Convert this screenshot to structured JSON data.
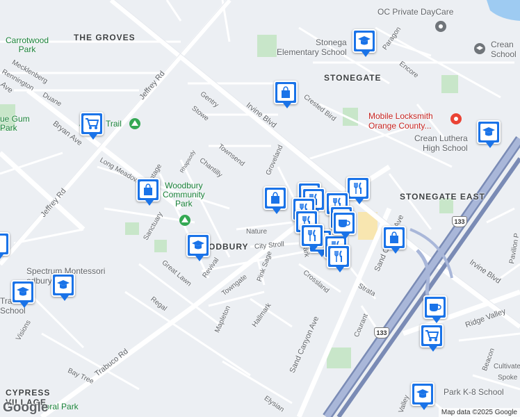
{
  "areas": [
    {
      "name": "the-groves",
      "text": "THE GROVES"
    },
    {
      "name": "stonegate",
      "text": "STONEGATE"
    },
    {
      "name": "stonegate-east",
      "text": "STONEGATE EAST"
    },
    {
      "name": "woodbury",
      "text": "ODBURY"
    },
    {
      "name": "cypress-village",
      "text": "CYPRESS\nVILLAGE"
    }
  ],
  "pois": {
    "carrotwood": "Carrotwood\nPark",
    "blue_gum": "ue Gum\nPark",
    "jeffrey_trail": "J",
    "jeffrey_trail2": "Trail",
    "woodbury_park": "Woodbury\nCommunity\nPark",
    "oc_daycare": "OC Private DayCare",
    "crean_top": "Crean\nSchool",
    "stonegate_elem": "Stonega\nElementary School",
    "locksmith": "Mobile Locksmith\nOrange County...",
    "crean_lutheran": "Crean Luthera\nHigh School",
    "spectrum": "Spectrum Montessori\nodbury",
    "trail_school": "Trai\nSchool",
    "park_k8": "Park K-8 School",
    "floral": "loral Park"
  },
  "roads": [
    {
      "text": "Irvine Blvd",
      "id": "irvine-blvd-1"
    },
    {
      "text": "Irvine Blvd",
      "id": "irvine-blvd-2"
    },
    {
      "text": "Jeffrey Rd",
      "id": "jeffrey-rd-1"
    },
    {
      "text": "Jeffrey Rd",
      "id": "jeffrey-rd-2"
    },
    {
      "text": "Bryan Ave",
      "id": "bryan-ave-1"
    },
    {
      "text": "Ave",
      "id": "bryan-ave-2"
    },
    {
      "text": "Trabuco Rd",
      "id": "trabuco-rd"
    },
    {
      "text": "Sand Canyon Ave",
      "id": "sand-canyon-1"
    },
    {
      "text": "Sand Canyon Ave",
      "id": "sand-canyon-2"
    },
    {
      "text": "Ridge Valley",
      "id": "ridge-valley"
    },
    {
      "text": "Gentry",
      "id": "gentry"
    },
    {
      "text": "Stowe",
      "id": "stowe"
    },
    {
      "text": "Townsend",
      "id": "townsend"
    },
    {
      "text": "Chantilly",
      "id": "chantilly"
    },
    {
      "text": "Groveland",
      "id": "groveland"
    },
    {
      "text": "Crested Bird",
      "id": "crested-bird"
    },
    {
      "text": "Encore",
      "id": "encore"
    },
    {
      "text": "Paragon",
      "id": "paragon"
    },
    {
      "text": "Long Meadow",
      "id": "long-meadow"
    },
    {
      "text": "Vintage",
      "id": "vintage"
    },
    {
      "text": "Rhapsody",
      "id": "rhapsody"
    },
    {
      "text": "Sanctuary",
      "id": "sanctuary"
    },
    {
      "text": "Nature",
      "id": "nature"
    },
    {
      "text": "City Stroll",
      "id": "city-stroll"
    },
    {
      "text": "Pink Sage",
      "id": "pink-sage"
    },
    {
      "text": "Revival",
      "id": "revival"
    },
    {
      "text": "Towngate",
      "id": "towngate"
    },
    {
      "text": "Great Lawn",
      "id": "great-lawn"
    },
    {
      "text": "Regal",
      "id": "regal"
    },
    {
      "text": "Mapleton",
      "id": "mapleton"
    },
    {
      "text": "Hallmark",
      "id": "hallmark"
    },
    {
      "text": "Hallmark",
      "id": "hallmark-2"
    },
    {
      "text": "Crossland",
      "id": "crossland"
    },
    {
      "text": "Strata",
      "id": "strata"
    },
    {
      "text": "Courant",
      "id": "courant"
    },
    {
      "text": "Visions",
      "id": "visions"
    },
    {
      "text": "Bay Tree",
      "id": "bay-tree"
    },
    {
      "text": "Elysian",
      "id": "elysian"
    },
    {
      "text": "Duane",
      "id": "duane"
    },
    {
      "text": "Mecklenberg",
      "id": "mecklenberg"
    },
    {
      "text": "Rennington",
      "id": "rennington"
    },
    {
      "text": "Beacon",
      "id": "beacon"
    },
    {
      "text": "Cultivate",
      "id": "cultivate"
    },
    {
      "text": "Spoke",
      "id": "spoke"
    },
    {
      "text": "Valley",
      "id": "valley"
    },
    {
      "text": "Pavilion P",
      "id": "pavilion"
    }
  ],
  "highways": [
    "133",
    "133"
  ],
  "branding": {
    "logo": "Google",
    "attribution": "Map data ©2025 Google"
  }
}
